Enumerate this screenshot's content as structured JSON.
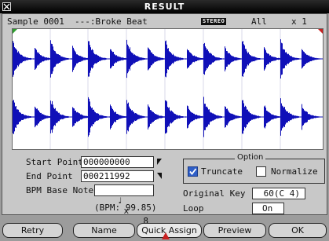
{
  "window": {
    "title": "RESULT",
    "close_icon": "close-x-icon"
  },
  "info": {
    "sample": "Sample 0001",
    "name": "---:Broke Beat",
    "stereo_badge": "STEREO",
    "nav_icon": "left-right-arrows-icon",
    "channel": "All",
    "zoom_icon": "up-down-triangles-icon",
    "zoom": "x 1"
  },
  "waveform": {
    "color": "#1010b8",
    "start_marker_color": "#2e9e2e",
    "end_marker_color": "#c82020"
  },
  "fields": {
    "start_point_label": "Start Point",
    "start_point": "000000000",
    "end_point_label": "End Point",
    "end_point": "000211992",
    "bpm_base_note_label": "BPM Base Note",
    "bpm_note_symbol": "♩",
    "bpm_note_mult": "x",
    "bpm_note_value": "8",
    "bpm_readout": "(BPM: 99.85)"
  },
  "option": {
    "title": "Option",
    "truncate_label": "Truncate",
    "truncate_checked": true,
    "normalize_label": "Normalize",
    "normalize_checked": false
  },
  "key": {
    "original_key_label": "Original Key",
    "original_key": "60(C 4)",
    "loop_label": "Loop",
    "loop": "On"
  },
  "buttons": {
    "retry": "Retry",
    "name": "Name",
    "quick_assign": "Quick Assign",
    "preview": "Preview",
    "ok": "OK"
  }
}
